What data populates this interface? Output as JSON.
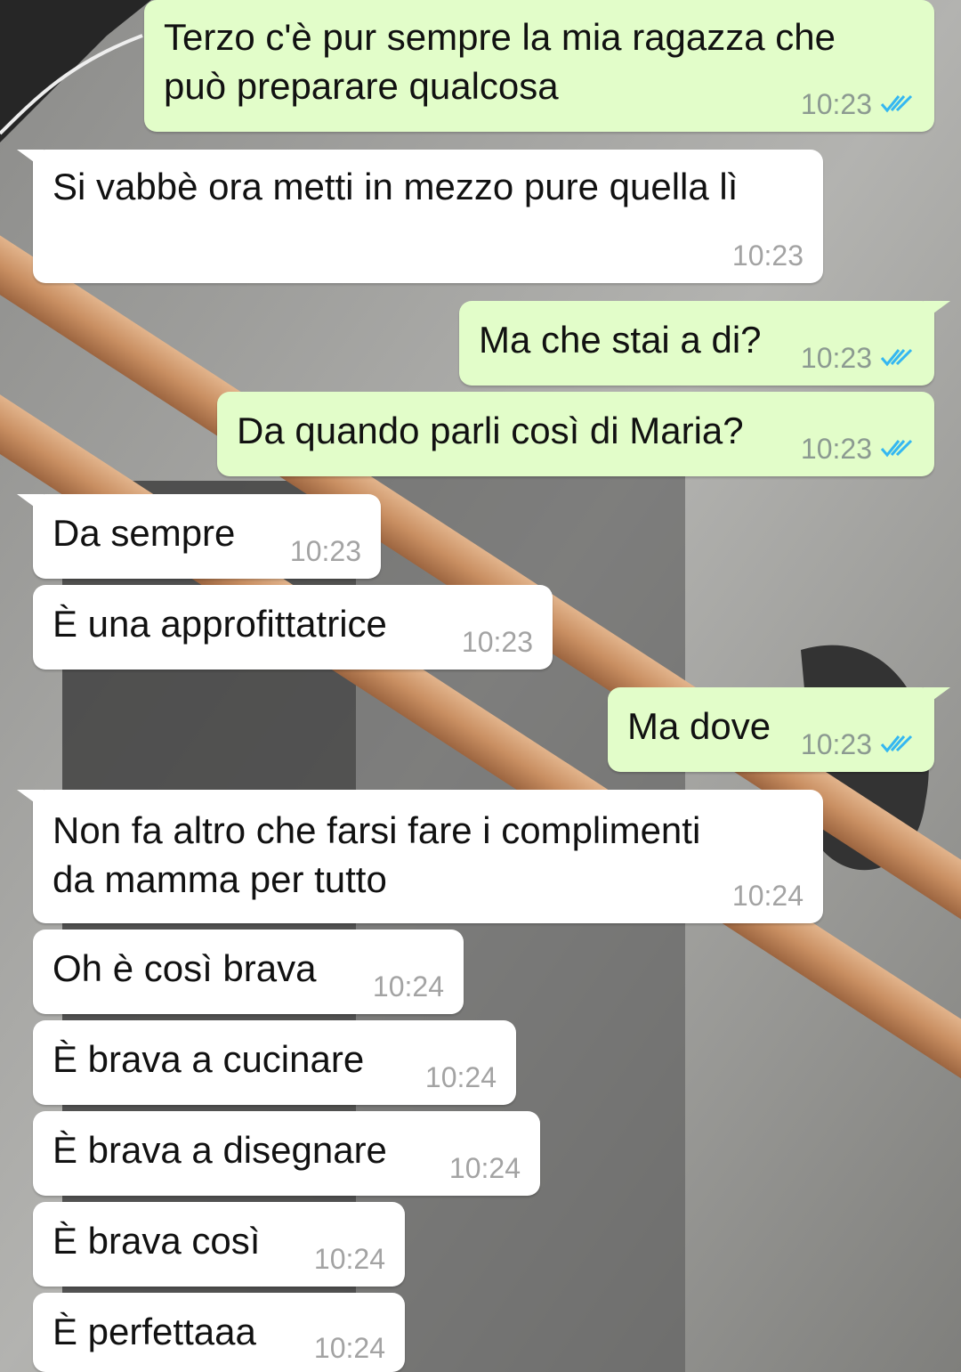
{
  "chat": {
    "messages": [
      {
        "text": "Terzo c'è pur sempre la mia ragazza che\npuò preparare qualcosa",
        "time": "10:23"
      },
      {
        "text": "Si vabbè ora metti in mezzo pure quella lì",
        "time": "10:23"
      },
      {
        "text": "Ma che stai a di?",
        "time": "10:23"
      },
      {
        "text": "Da quando parli così di Maria?",
        "time": "10:23"
      },
      {
        "text": "Da sempre",
        "time": "10:23"
      },
      {
        "text": "È una approfittatrice",
        "time": "10:23"
      },
      {
        "text": "Ma dove",
        "time": "10:23"
      },
      {
        "text": "Non fa altro che farsi fare i complimenti\nda mamma per tutto",
        "time": "10:24"
      },
      {
        "text": "Oh è così brava",
        "time": "10:24"
      },
      {
        "text": "È brava a cucinare",
        "time": "10:24"
      },
      {
        "text": "È brava a disegnare",
        "time": "10:24"
      },
      {
        "text": "È brava così",
        "time": "10:24"
      },
      {
        "text": "È perfettaaa",
        "time": "10:24"
      }
    ],
    "read_icon": "double-check-icon",
    "colors": {
      "outgoing": "#e2fdc9",
      "incoming": "#ffffff",
      "read_tick": "#34b7f1"
    }
  }
}
